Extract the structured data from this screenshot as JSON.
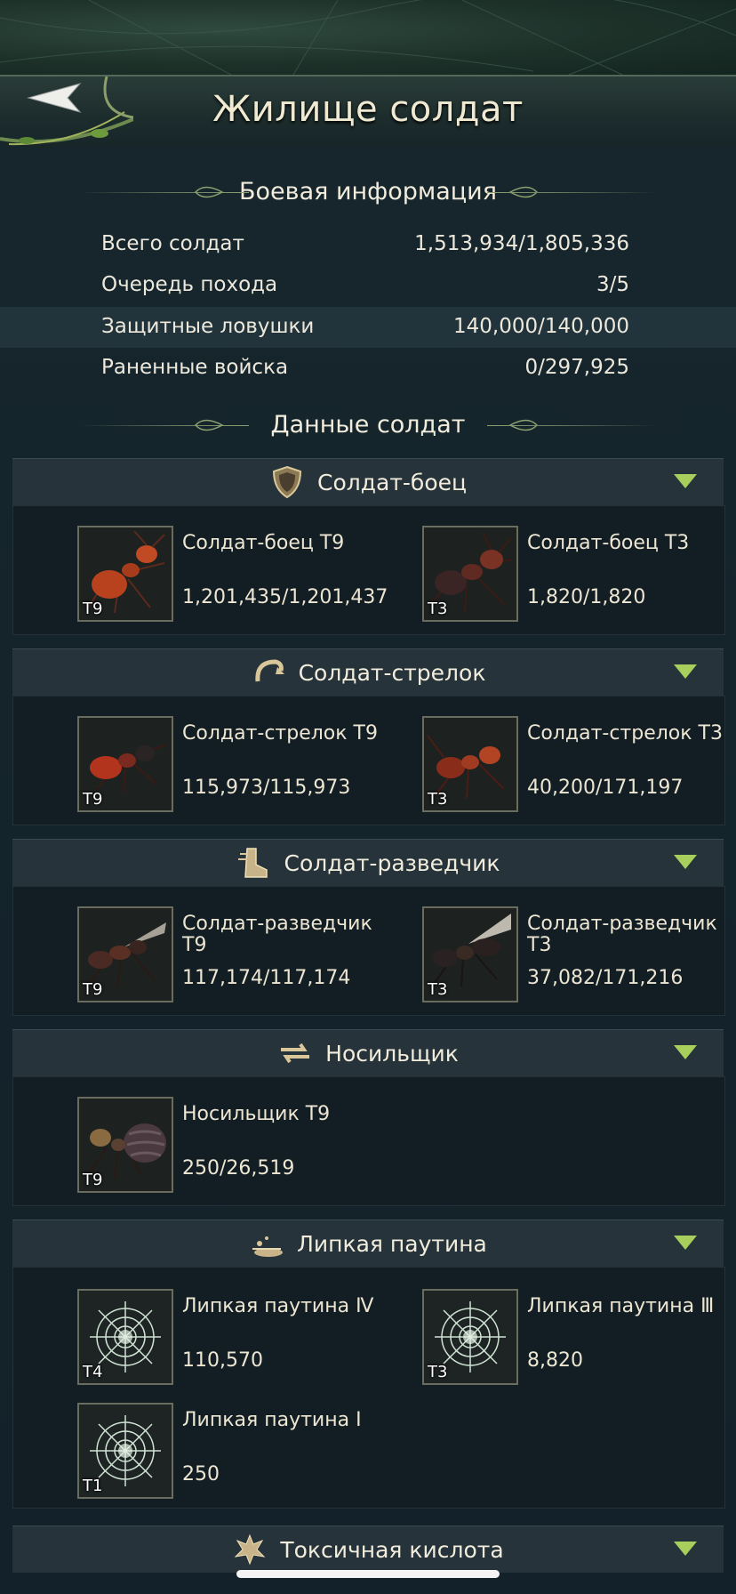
{
  "header": {
    "title": "Жилище солдат"
  },
  "battle_info": {
    "heading": "Боевая информация",
    "rows": [
      {
        "label": "Всего солдат",
        "value": "1,513,934/1,805,336"
      },
      {
        "label": "Очередь похода",
        "value": "3/5"
      },
      {
        "label": "Защитные ловушки",
        "value": "140,000/140,000"
      },
      {
        "label": "Раненные войска",
        "value": "0/297,925"
      }
    ]
  },
  "soldier_data": {
    "heading": "Данные солдат"
  },
  "categories": [
    {
      "name": "Солдат-боец",
      "icon": "shield-icon",
      "units": [
        {
          "name": "Солдат-боец T9",
          "count": "1,201,435/1,201,437",
          "tier": "T9"
        },
        {
          "name": "Солдат-боец T3",
          "count": "1,820/1,820",
          "tier": "T3"
        }
      ]
    },
    {
      "name": "Солдат-стрелок",
      "icon": "bow-icon",
      "units": [
        {
          "name": "Солдат-стрелок T9",
          "count": "115,973/115,973",
          "tier": "T9"
        },
        {
          "name": "Солдат-стрелок T3",
          "count": "40,200/171,197",
          "tier": "T3"
        }
      ]
    },
    {
      "name": "Солдат-разведчик",
      "icon": "boot-icon",
      "units": [
        {
          "name": "Солдат-разведчик T9",
          "count": "117,174/117,174",
          "tier": "T9"
        },
        {
          "name": "Солдат-разведчик T3",
          "count": "37,082/171,216",
          "tier": "T3"
        }
      ]
    },
    {
      "name": "Носильщик",
      "icon": "transfer-icon",
      "units": [
        {
          "name": "Носильщик T9",
          "count": "250/26,519",
          "tier": "T9"
        }
      ]
    },
    {
      "name": "Липкая паутина",
      "icon": "sticky-web-icon",
      "units": [
        {
          "name": "Липкая паутина Ⅳ",
          "count": "110,570",
          "tier": "T4"
        },
        {
          "name": "Липкая паутина Ⅲ",
          "count": "8,820",
          "tier": "T3"
        },
        {
          "name": "Липкая паутина Ⅰ",
          "count": "250",
          "tier": "T1"
        }
      ]
    },
    {
      "name": "Токсичная кислота",
      "icon": "toxic-acid-icon",
      "units": []
    }
  ],
  "colors": {
    "accent": "#a8cf5c",
    "title": "#f1ead2"
  }
}
